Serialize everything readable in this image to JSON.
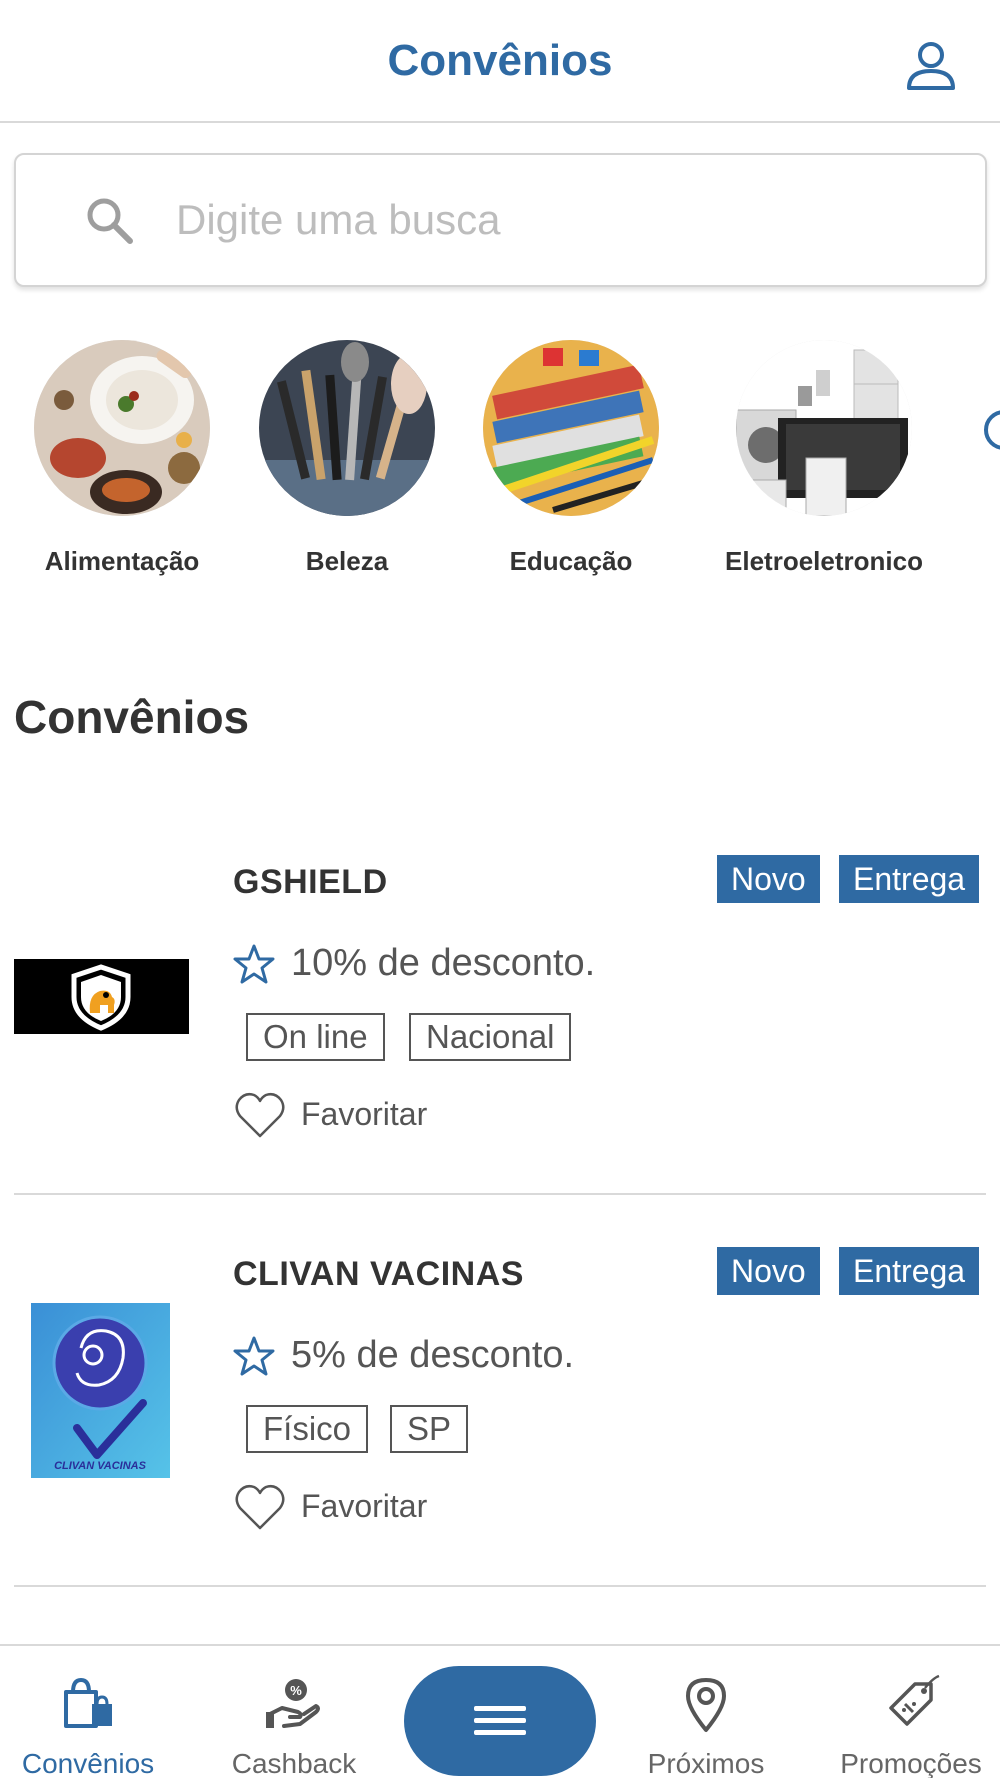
{
  "header": {
    "title": "Convênios",
    "profile_icon": "user-icon"
  },
  "search": {
    "placeholder": "Digite uma busca",
    "value": "",
    "icon": "search-icon"
  },
  "categories": [
    {
      "label": "Alimentação",
      "image": "food-photo"
    },
    {
      "label": "Beleza",
      "image": "makeup-brushes-photo"
    },
    {
      "label": "Educação",
      "image": "school-supplies-photo"
    },
    {
      "label": "Eletroeletronico",
      "image": "appliances-photo"
    }
  ],
  "section": {
    "title": "Convênios"
  },
  "partners": [
    {
      "name": "GSHIELD",
      "badges": [
        "Novo",
        "Entrega"
      ],
      "discount": "10% de desconto.",
      "tags": [
        "On line",
        "Nacional"
      ],
      "favorite_label": "Favoritar",
      "logo": "gshield-logo"
    },
    {
      "name": "CLIVAN VACINAS",
      "badges": [
        "Novo",
        "Entrega"
      ],
      "discount": "5% de desconto.",
      "tags": [
        "Físico",
        "SP"
      ],
      "favorite_label": "Favoritar",
      "logo": "clivan-vacinas-logo",
      "logo_text": "CLIVAN VACINAS"
    }
  ],
  "tabbar": {
    "tabs": [
      {
        "label": "Convênios",
        "icon": "shopping-bags-icon",
        "active": true
      },
      {
        "label": "Cashback",
        "icon": "hand-coin-icon",
        "active": false
      },
      {
        "label": "Próximos",
        "icon": "map-pin-icon",
        "active": false
      },
      {
        "label": "Promoções",
        "icon": "price-tag-icon",
        "active": false
      }
    ],
    "menu_icon": "hamburger-menu-icon"
  },
  "colors": {
    "accent": "#2f6aa3",
    "text": "#333333",
    "muted": "#555555",
    "divider": "#d9d9d9"
  }
}
